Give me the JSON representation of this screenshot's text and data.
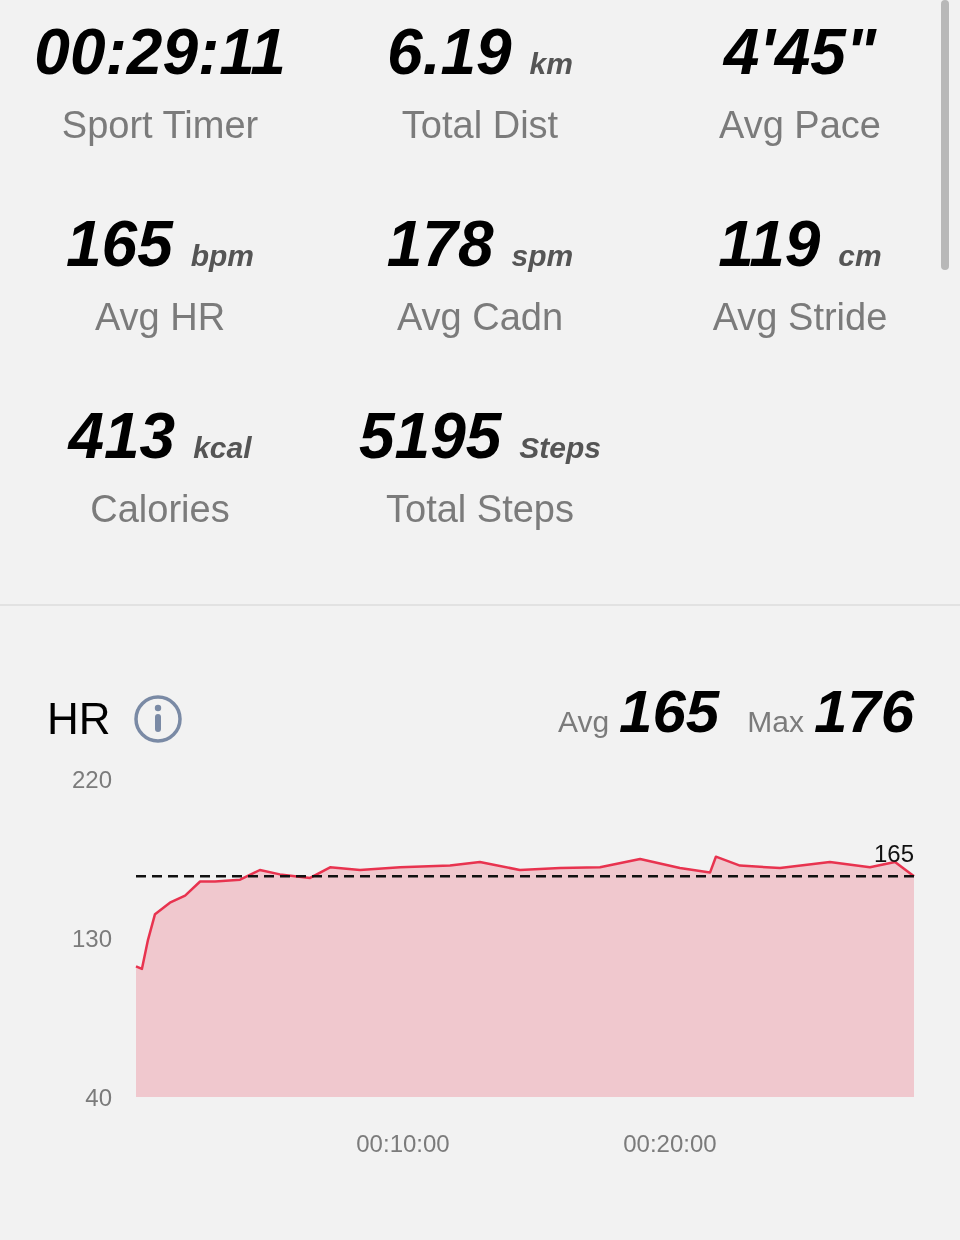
{
  "stats": [
    {
      "value": "00:29:11",
      "label": "Sport Timer"
    },
    {
      "value": "6.19",
      "unit": "km",
      "label": "Total Dist"
    },
    {
      "value": "4'45\"",
      "label": "Avg Pace"
    },
    {
      "value": "165",
      "unit": "bpm",
      "label": "Avg HR"
    },
    {
      "value": "178",
      "unit": "spm",
      "label": "Avg Cadn"
    },
    {
      "value": "119",
      "unit": "cm",
      "label": "Avg Stride"
    },
    {
      "value": "413",
      "unit": "kcal",
      "label": "Calories"
    },
    {
      "value": "5195",
      "unit": "Steps",
      "label": "Total Steps"
    }
  ],
  "hr": {
    "title": "HR",
    "avg_label": "Avg",
    "avg_value": "165",
    "max_label": "Max",
    "max_value": "176",
    "chart_data": {
      "type": "area",
      "xlim": [
        0,
        29.14
      ],
      "ylim": [
        40,
        220
      ],
      "yticks": [
        220,
        130,
        40
      ],
      "xticks": [
        {
          "value": 10,
          "label": "00:10:00"
        },
        {
          "value": 20,
          "label": "00:20:00"
        }
      ],
      "ref_lines": [
        {
          "axis": "y",
          "value": 165,
          "label": "165"
        }
      ],
      "x": [
        0,
        0.22,
        0.45,
        0.71,
        1.27,
        1.84,
        2.4,
        2.96,
        3.9,
        4.64,
        5.39,
        6.52,
        7.27,
        8.39,
        9.89,
        11.76,
        12.88,
        14.38,
        15.88,
        17.38,
        18.88,
        20.37,
        21.5,
        21.72,
        22.62,
        24.12,
        25.99,
        27.49,
        28.43,
        29.14
      ],
      "series": [
        {
          "color": "#e8334f",
          "values": [
            114,
            112.5,
            129,
            143.5,
            150,
            154,
            162,
            162,
            163,
            168.5,
            166,
            164,
            170,
            168.5,
            170,
            171,
            173,
            168.5,
            169.6,
            170,
            174.7,
            169.6,
            167,
            176,
            171,
            169.6,
            173,
            170,
            173,
            165
          ]
        }
      ]
    }
  }
}
